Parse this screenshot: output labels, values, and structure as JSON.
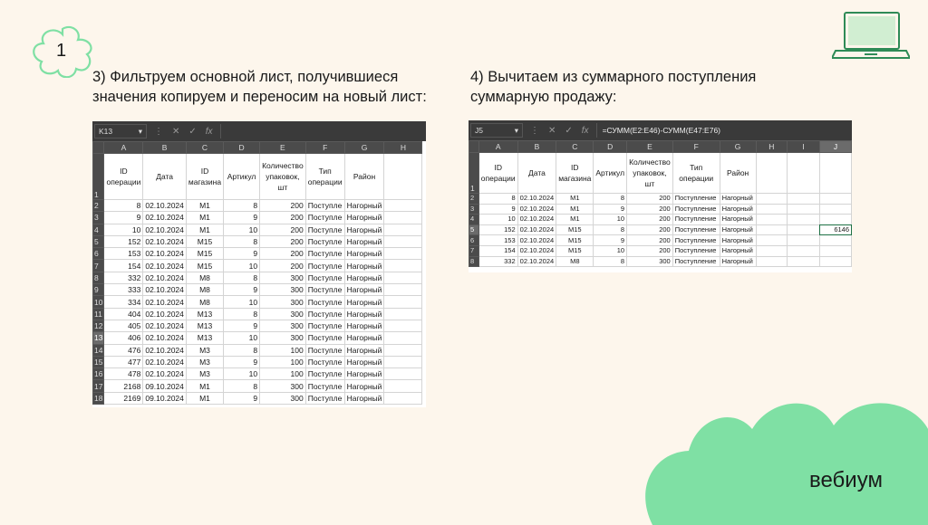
{
  "page_number": "1",
  "brand": "вебиум",
  "colors": {
    "background": "#fdf6ec",
    "accent_green": "#7fe0a4",
    "excel_header": "#4b4b4b",
    "excel_bar": "#3a3a3a"
  },
  "icons": [
    "flower-badge-icon",
    "laptop-icon",
    "green-cloud-blob",
    "fx-icon"
  ],
  "steps": {
    "left": "3) Фильтруем основной лист, получившиеся значения копируем и переносим на новый лист:",
    "right": "4) Вычитаем из суммарного поступления суммарную продажу:"
  },
  "left_sheet": {
    "name_box": "K13",
    "formula": "",
    "columns": [
      "A",
      "B",
      "C",
      "D",
      "E",
      "F",
      "G",
      "H"
    ],
    "headers": [
      "ID операции",
      "Дата",
      "ID магазина",
      "Артикул",
      "Количество упаковок, шт",
      "Тип операции",
      "Район",
      ""
    ],
    "row_numbers": [
      "1",
      "2",
      "3",
      "4",
      "5",
      "6",
      "7",
      "8",
      "9",
      "10",
      "11",
      "12",
      "13",
      "14",
      "15",
      "16",
      "17",
      "18"
    ],
    "rows": [
      [
        "8",
        "02.10.2024",
        "M1",
        "8",
        "200",
        "Поступле",
        "Нагорный",
        ""
      ],
      [
        "9",
        "02.10.2024",
        "M1",
        "9",
        "200",
        "Поступле",
        "Нагорный",
        ""
      ],
      [
        "10",
        "02.10.2024",
        "M1",
        "10",
        "200",
        "Поступле",
        "Нагорный",
        ""
      ],
      [
        "152",
        "02.10.2024",
        "M15",
        "8",
        "200",
        "Поступле",
        "Нагорный",
        ""
      ],
      [
        "153",
        "02.10.2024",
        "M15",
        "9",
        "200",
        "Поступле",
        "Нагорный",
        ""
      ],
      [
        "154",
        "02.10.2024",
        "M15",
        "10",
        "200",
        "Поступле",
        "Нагорный",
        ""
      ],
      [
        "332",
        "02.10.2024",
        "M8",
        "8",
        "300",
        "Поступле",
        "Нагорный",
        ""
      ],
      [
        "333",
        "02.10.2024",
        "M8",
        "9",
        "300",
        "Поступле",
        "Нагорный",
        ""
      ],
      [
        "334",
        "02.10.2024",
        "M8",
        "10",
        "300",
        "Поступле",
        "Нагорный",
        ""
      ],
      [
        "404",
        "02.10.2024",
        "M13",
        "8",
        "300",
        "Поступле",
        "Нагорный",
        ""
      ],
      [
        "405",
        "02.10.2024",
        "M13",
        "9",
        "300",
        "Поступле",
        "Нагорный",
        ""
      ],
      [
        "406",
        "02.10.2024",
        "M13",
        "10",
        "300",
        "Поступле",
        "Нагорный",
        ""
      ],
      [
        "476",
        "02.10.2024",
        "M3",
        "8",
        "100",
        "Поступле",
        "Нагорный",
        ""
      ],
      [
        "477",
        "02.10.2024",
        "M3",
        "9",
        "100",
        "Поступле",
        "Нагорный",
        ""
      ],
      [
        "478",
        "02.10.2024",
        "M3",
        "10",
        "100",
        "Поступле",
        "Нагорный",
        ""
      ],
      [
        "2168",
        "09.10.2024",
        "M1",
        "8",
        "300",
        "Поступле",
        "Нагорный",
        ""
      ],
      [
        "2169",
        "09.10.2024",
        "M1",
        "9",
        "300",
        "Поступле",
        "Нагорный",
        ""
      ]
    ],
    "selected_row": "13"
  },
  "right_sheet": {
    "name_box": "J5",
    "formula": "=СУММ(E2:E46)-СУММ(E47:E76)",
    "columns": [
      "A",
      "B",
      "C",
      "D",
      "E",
      "F",
      "G",
      "H",
      "I",
      "J"
    ],
    "headers": [
      "ID операции",
      "Дата",
      "ID магазина",
      "Артикул",
      "Количество упаковок, шт",
      "Тип операции",
      "Район",
      "",
      "",
      ""
    ],
    "row_numbers": [
      "1",
      "2",
      "3",
      "4",
      "5",
      "6",
      "7",
      "8"
    ],
    "rows": [
      [
        "8",
        "02.10.2024",
        "M1",
        "8",
        "200",
        "Поступление",
        "Нагорный",
        "",
        "",
        ""
      ],
      [
        "9",
        "02.10.2024",
        "M1",
        "9",
        "200",
        "Поступление",
        "Нагорный",
        "",
        "",
        ""
      ],
      [
        "10",
        "02.10.2024",
        "M1",
        "10",
        "200",
        "Поступление",
        "Нагорный",
        "",
        "",
        ""
      ],
      [
        "152",
        "02.10.2024",
        "M15",
        "8",
        "200",
        "Поступление",
        "Нагорный",
        "",
        "",
        "6146"
      ],
      [
        "153",
        "02.10.2024",
        "M15",
        "9",
        "200",
        "Поступление",
        "Нагорный",
        "",
        "",
        ""
      ],
      [
        "154",
        "02.10.2024",
        "M15",
        "10",
        "200",
        "Поступление",
        "Нагорный",
        "",
        "",
        ""
      ],
      [
        "332",
        "02.10.2024",
        "M8",
        "8",
        "300",
        "Поступление",
        "Нагорный",
        "",
        "",
        ""
      ]
    ],
    "selected_row": "5",
    "selected_col": "J"
  }
}
